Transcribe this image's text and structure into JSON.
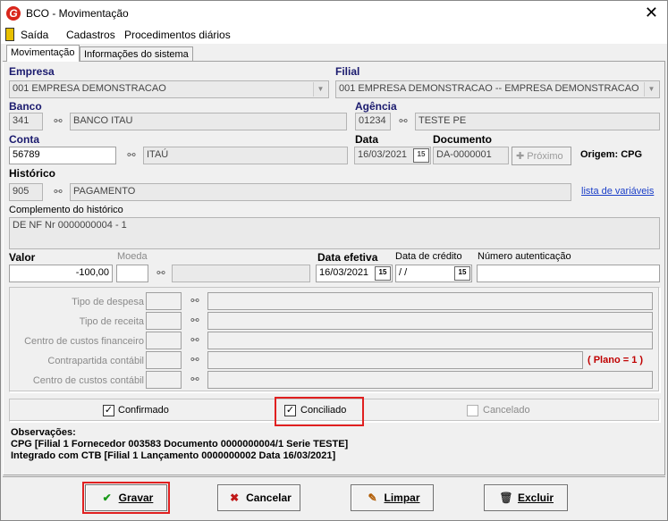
{
  "window": {
    "title": "BCO - Movimentação",
    "close": "✕",
    "logo": "G"
  },
  "menu": {
    "exit": "Saída",
    "cadastros": "Cadastros",
    "procedimentos": "Procedimentos diários"
  },
  "tabs": [
    {
      "label": "Movimentação"
    },
    {
      "label": "Informações do sistema"
    }
  ],
  "empresa": {
    "label": "Empresa",
    "value": "001 EMPRESA DEMONSTRACAO"
  },
  "filial": {
    "label": "Filial",
    "value": "001 EMPRESA DEMONSTRACAO -- EMPRESA DEMONSTRACAO"
  },
  "banco": {
    "label": "Banco",
    "code": "341",
    "name": "BANCO ITAU"
  },
  "agencia": {
    "label": "Agência",
    "code": "01234",
    "name": "TESTE PE"
  },
  "conta": {
    "label": "Conta",
    "code": "56789",
    "name": "ITAÚ"
  },
  "data": {
    "label": "Data",
    "value": "16/03/2021"
  },
  "documento": {
    "label": "Documento",
    "value": "DA-0000001"
  },
  "proximo": {
    "label": "Próximo"
  },
  "origem": {
    "label": "Origem: CPG"
  },
  "historico": {
    "label": "Histórico",
    "code": "905",
    "name": "PAGAMENTO",
    "link": "lista de variáveis"
  },
  "complemento": {
    "label": "Complemento do histórico",
    "value": "DE NF Nr 0000000004 - 1"
  },
  "valor": {
    "label": "Valor",
    "value": "-100,00"
  },
  "moeda": {
    "label": "Moeda",
    "value": ""
  },
  "data_efetiva": {
    "label": "Data efetiva",
    "value": "16/03/2021"
  },
  "data_credito": {
    "label": "Data de crédito",
    "value": " / /"
  },
  "numero_autenticacao": {
    "label": "Número autenticação",
    "value": ""
  },
  "classificacao": {
    "tipo_despesa": "Tipo de despesa",
    "tipo_receita": "Tipo de receita",
    "centro_custos_financeiro": "Centro de custos financeiro",
    "contrapartida_contabil": "Contrapartida contábil",
    "centro_custos_contabil": "Centro de custos contábil",
    "plano": "( Plano = 1 )"
  },
  "status": {
    "confirmado": {
      "label": "Confirmado",
      "checked": true
    },
    "conciliado": {
      "label": "Conciliado",
      "checked": true
    },
    "cancelado": {
      "label": "Cancelado",
      "checked": false
    }
  },
  "observacoes": {
    "label": "Observações:",
    "line1": "CPG [Filial 1 Fornecedor 003583 Documento 0000000004/1 Serie TESTE]",
    "line2": "Integrado com CTB [Filial 1 Lançamento 0000000002 Data 16/03/2021]"
  },
  "buttons": {
    "gravar": "Gravar",
    "cancelar": "Cancelar",
    "limpar": "Limpar",
    "excluir": "Excluir"
  },
  "colors": {
    "highlight": "#e02020",
    "label_blue": "#1a1a6e",
    "link": "#1a3ec8",
    "plano": "#c00000"
  },
  "icons": {
    "binoculars": "⚯",
    "calendar": "15",
    "check": "✓"
  }
}
